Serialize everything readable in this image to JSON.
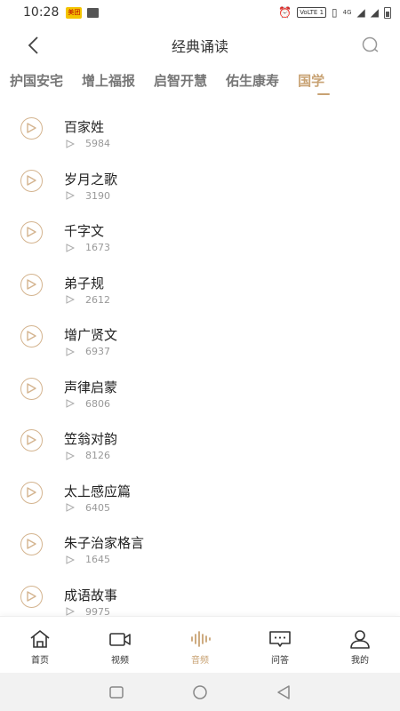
{
  "status_bar": {
    "time": "10:28",
    "app_badge": "美团",
    "volte": "VoLTE 1",
    "network": "4G"
  },
  "header": {
    "title": "经典诵读",
    "back_icon": "chevron-left-icon",
    "search_icon": "search-icon"
  },
  "tabs": [
    {
      "label": "护国安宅",
      "active": false
    },
    {
      "label": "增上福报",
      "active": false
    },
    {
      "label": "启智开慧",
      "active": false
    },
    {
      "label": "佑生康寿",
      "active": false
    },
    {
      "label": "国学",
      "active": true
    }
  ],
  "items": [
    {
      "title": "百家姓",
      "plays": "5984"
    },
    {
      "title": "岁月之歌",
      "plays": "3190"
    },
    {
      "title": "千字文",
      "plays": "1673"
    },
    {
      "title": "弟子规",
      "plays": "2612"
    },
    {
      "title": "增广贤文",
      "plays": "6937"
    },
    {
      "title": "声律启蒙",
      "plays": "6806"
    },
    {
      "title": "笠翁对韵",
      "plays": "8126"
    },
    {
      "title": "太上感应篇",
      "plays": "6405"
    },
    {
      "title": "朱子治家格言",
      "plays": "1645"
    },
    {
      "title": "成语故事",
      "plays": "9975"
    }
  ],
  "bottom_nav": [
    {
      "label": "首页",
      "icon": "home-icon",
      "active": false
    },
    {
      "label": "视频",
      "icon": "video-icon",
      "active": false
    },
    {
      "label": "音频",
      "icon": "audio-wave-icon",
      "active": true
    },
    {
      "label": "问答",
      "icon": "chat-icon",
      "active": false
    },
    {
      "label": "我的",
      "icon": "user-icon",
      "active": false
    }
  ],
  "colors": {
    "accent": "#c8a273",
    "play_circle": "#d4b48f",
    "text": "#222222",
    "muted": "#999999"
  }
}
